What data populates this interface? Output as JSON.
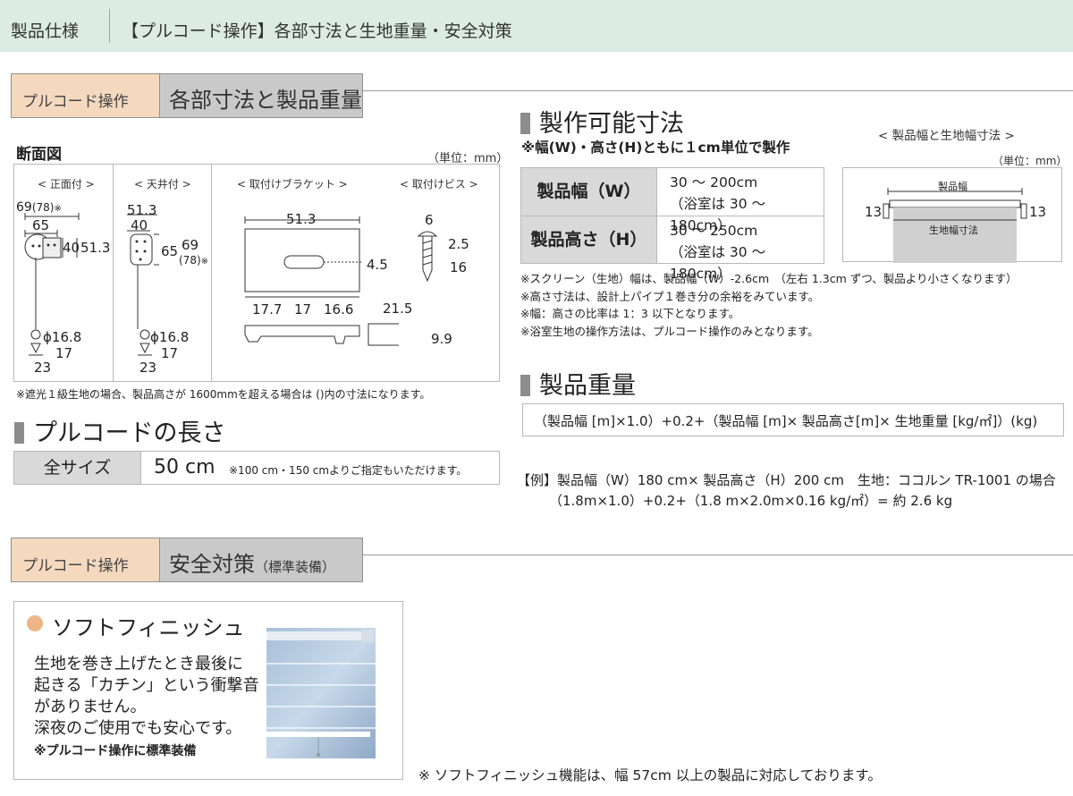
{
  "header": {
    "left": "製品仕様",
    "title": "【プルコード操作】各部寸法と生地重量・安全対策"
  },
  "section1": {
    "tab_label": "プルコード操作",
    "tab_title": "各部寸法と製品重量"
  },
  "cross_section": {
    "title": "断面図",
    "unit": "（単位：mm）",
    "front": {
      "label": "< 正面付 >",
      "d69": "69",
      "d78": "(78)",
      "mark": "※",
      "d65": "65",
      "d40": "40",
      "d513": "51.3",
      "phi": "ϕ16.8",
      "d17": "17",
      "d23": "23"
    },
    "ceiling": {
      "label": "< 天井付 >",
      "d513": "51.3",
      "d40": "40",
      "d65": "65",
      "d69": "69",
      "d78": "(78)",
      "mark": "※",
      "phi": "ϕ16.8",
      "d17": "17",
      "d23": "23"
    },
    "bracket": {
      "label": "< 取付けブラケット >",
      "d513": "51.3",
      "d45": "4.5",
      "d177": "17.7",
      "d17": "17",
      "d166": "16.6",
      "d215": "21.5",
      "d99": "9.9"
    },
    "screw": {
      "label": "< 取付けビス >",
      "d6": "6",
      "d25": "2.5",
      "d16": "16"
    },
    "footnote": "※遮光１級生地の場合、製品高さが 1600mmを超える場合は ()内の寸法になります。"
  },
  "cord": {
    "heading": "プルコードの長さ",
    "label": "全サイズ",
    "value": "50 cm",
    "note": "※100 cm・150 cmよりご指定もいただけます。"
  },
  "sizes": {
    "heading": "製作可能寸法",
    "sub": "※幅(W)・高さ(H)ともに１cm単位で製作",
    "rows": [
      {
        "label": "製品幅（W）",
        "line1": "30 〜 200cm",
        "line2": "（浴室は 30 〜 180cm）"
      },
      {
        "label": "製品高さ（H）",
        "line1": "30 〜 250cm",
        "line2": "（浴室は 30 〜 180cm）"
      }
    ],
    "diagram": {
      "caption": "< 製品幅と生地幅寸法 >",
      "unit": "（単位：mm）",
      "product_width": "製品幅",
      "fabric_width": "生地幅寸法",
      "left": "13",
      "right": "13"
    },
    "notes": [
      "※スクリーン（生地）幅は、製品幅（W）-2.6cm　（左右 1.3cm ずつ、製品より小さくなります）",
      "※高さ寸法は、設計上パイプ１巻き分の余裕をみています。",
      "※幅：高さの比率は 1：3 以下となります。",
      "※浴室生地の操作方法は、プルコード操作のみとなります。"
    ]
  },
  "weight": {
    "heading": "製品重量",
    "formula": "（製品幅 [m]×1.0）+0.2+（製品幅 [m]× 製品高さ[m]× 生地重量 [kg/㎡]）(kg)",
    "example1": "【例】製品幅（W）180 cm× 製品高さ（H）200 cm　生地：ココルン TR-1001 の場合",
    "example2": "（1.8m×1.0）+0.2+（1.8 m×2.0m×0.16 kg/㎡）= 約 2.6 kg"
  },
  "section2": {
    "tab_label": "プルコード操作",
    "tab_title": "安全対策",
    "tab_sub": "（標準装備）"
  },
  "soft": {
    "title": "ソフトフィニッシュ",
    "lines": [
      "生地を巻き上げたとき最後に",
      "起きる「カチン」という衝撃音",
      "がありません。",
      "深夜のご使用でも安心です。"
    ],
    "note": "※プルコード操作に標準装備",
    "footnote": "※ ソフトフィニッシュ機能は、幅 57cm 以上の製品に対応しております。"
  },
  "colors": {
    "header_bg": "#dcebe4",
    "tab_orange": "#f4d9bf",
    "tab_gray": "#c9c9c9",
    "accent_dot": "#efb487"
  }
}
